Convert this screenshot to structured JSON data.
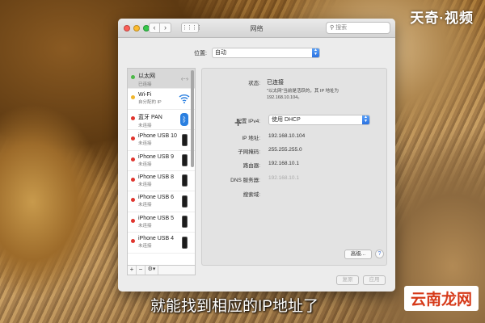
{
  "watermark": "天奇·视频",
  "subtitle": "就能找到相应的IP地址了",
  "site_logo": "云南龙网",
  "window": {
    "title": "网络",
    "search_placeholder": "搜索",
    "nav_back": "‹",
    "nav_forward": "›",
    "grid": "⋮⋮⋮⋮"
  },
  "location": {
    "label": "位置:",
    "value": "自动"
  },
  "services": [
    {
      "name": "以太网",
      "status": "已连接",
      "dot": "green",
      "icon": "ethernet-icon",
      "selected": true
    },
    {
      "name": "Wi-Fi",
      "status": "自分配的 IP",
      "dot": "yellow",
      "icon": "wifi-icon"
    },
    {
      "name": "蓝牙 PAN",
      "status": "未连接",
      "dot": "red",
      "icon": "bluetooth-icon"
    },
    {
      "name": "iPhone USB 10",
      "status": "未连接",
      "dot": "red",
      "icon": "iphone-icon"
    },
    {
      "name": "iPhone USB 9",
      "status": "未连接",
      "dot": "red",
      "icon": "iphone-icon"
    },
    {
      "name": "iPhone USB 8",
      "status": "未连接",
      "dot": "red",
      "icon": "iphone-icon"
    },
    {
      "name": "iPhone USB 6",
      "status": "未连接",
      "dot": "red",
      "icon": "iphone-icon"
    },
    {
      "name": "iPhone USB 5",
      "status": "未连接",
      "dot": "red",
      "icon": "iphone-icon"
    },
    {
      "name": "iPhone USB 4",
      "status": "未连接",
      "dot": "red",
      "icon": "iphone-icon"
    }
  ],
  "sidebar_tools": {
    "add": "+",
    "remove": "−",
    "gear": "⚙▾"
  },
  "detail": {
    "status_label": "状态:",
    "status_value": "已连接",
    "status_desc": "\"以太网\"当前是活跃的，其 IP 地址为 192.168.10.104。",
    "config_label": "配置 IPv4:",
    "config_value": "使用 DHCP",
    "ip_label": "IP 地址:",
    "ip_value": "192.168.10.104",
    "subnet_label": "子网掩码:",
    "subnet_value": "255.255.255.0",
    "router_label": "路由器:",
    "router_value": "192.168.10.1",
    "dns_label": "DNS 服务器:",
    "dns_value": "192.168.10.1",
    "search_domain_label": "搜索域:",
    "advanced_label": "高级...",
    "help_label": "?"
  },
  "footer": {
    "revert_label": "复原",
    "apply_label": "应用"
  }
}
